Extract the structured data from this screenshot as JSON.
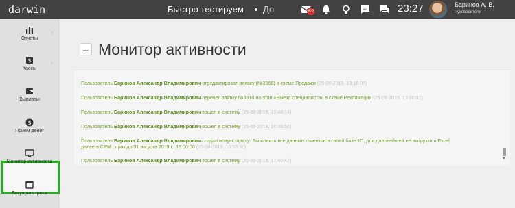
{
  "topbar": {
    "logo": "darwin",
    "title": "Быстро тестируем",
    "title_tail": "До",
    "mail_badge": "6/2",
    "clock": "23:27",
    "user_name": "Баринов А. В.",
    "user_role": "Руководители",
    "icons": [
      "mail-icon",
      "bell-icon",
      "lightbulb-icon",
      "chat-icon",
      "messages-icon"
    ]
  },
  "sidebar": {
    "items": [
      {
        "label": "Отчеты",
        "icon": "bar-chart-icon",
        "has_arrow": true
      },
      {
        "label": "Кассы",
        "icon": "cash-register-icon",
        "has_arrow": true
      },
      {
        "label": "Выплаты",
        "icon": "wallet-icon",
        "has_arrow": false
      },
      {
        "label": "Прием денег",
        "icon": "dollar-coin-icon",
        "has_arrow": false
      },
      {
        "label": "Монитор активности",
        "icon": "monitor-icon",
        "has_arrow": false,
        "active": true
      },
      {
        "label": "Бегущая строка",
        "icon": "ticker-icon",
        "has_arrow": false
      }
    ],
    "active_color": "#21b31b"
  },
  "main": {
    "title": "Монитор активности",
    "back_label": "←",
    "log": [
      {
        "prefix": "Пользователь ",
        "user": "Баринов Александр Владимирович",
        "action": " отредактировал заявку (№3968) в схеме Продажи",
        "time": " (25-08-2019, 13:18:07)"
      },
      {
        "prefix": "Пользователь ",
        "user": "Баринов Александр Владимирович",
        "action": " перевел заявку №3810 на этап «Выезд специалиста» в схеме Рекламации",
        "time": " (25-08-2019, 13:36:02)"
      },
      {
        "prefix": "Пользователь ",
        "user": "Баринов Александр Владимирович",
        "action": " вошел в систему",
        "time": " (25-08-2019, 13:48:14)"
      },
      {
        "prefix": "Пользователь ",
        "user": "Баринов Александр Владимирович",
        "action": " вошел в систему",
        "time": " (25-08-2019, 16:49:56)"
      },
      {
        "prefix": "Пользователь ",
        "user": "Баринов Александр Владимирович",
        "action": " создал новую задачу: Заполнить все данные клиентов в своей базе 1С, для дальнейшей её выгрузки в Excel,",
        "action2": "далее в CRM , срок до 31 августа 2019 г., 18:00:00",
        "time": " (25-08-2019, 16:53:30)"
      },
      {
        "prefix": "Пользователь ",
        "user": "Баринов Александр Владимирович",
        "action": " вошел в систему",
        "time": " (25-08-2019, 17:40:42)"
      }
    ],
    "colors": {
      "log_text": "#74a12e",
      "timestamp": "#c3c3c3"
    }
  }
}
